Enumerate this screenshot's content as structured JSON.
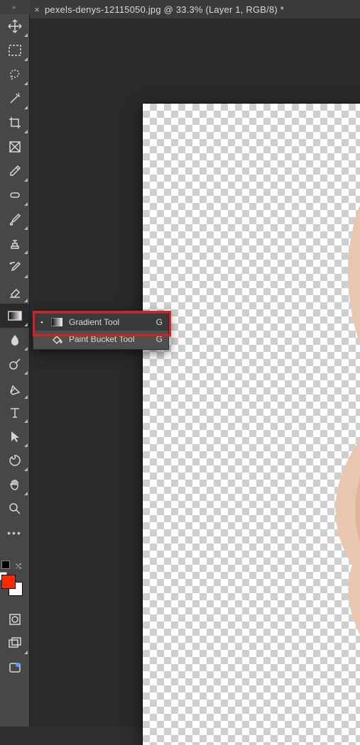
{
  "tab": {
    "close_glyph": "×",
    "title": "pexels-denys-12115050.jpg @ 33.3% (Layer 1, RGB/8) *"
  },
  "toolbar": {
    "tools": [
      {
        "name": "move-tool",
        "active": false,
        "flyout": true
      },
      {
        "name": "rectangular-marquee-tool",
        "active": false,
        "flyout": true
      },
      {
        "name": "lasso-tool",
        "active": false,
        "flyout": true
      },
      {
        "name": "magic-wand-tool",
        "active": false,
        "flyout": true
      },
      {
        "name": "crop-tool",
        "active": false,
        "flyout": true
      },
      {
        "name": "frame-tool",
        "active": false,
        "flyout": false
      },
      {
        "name": "eyedropper-tool",
        "active": false,
        "flyout": true
      },
      {
        "name": "healing-brush-tool",
        "active": false,
        "flyout": true
      },
      {
        "name": "brush-tool",
        "active": false,
        "flyout": true
      },
      {
        "name": "clone-stamp-tool",
        "active": false,
        "flyout": true
      },
      {
        "name": "history-brush-tool",
        "active": false,
        "flyout": true
      },
      {
        "name": "eraser-tool",
        "active": false,
        "flyout": true
      },
      {
        "name": "gradient-tool",
        "active": true,
        "flyout": true
      },
      {
        "name": "blur-tool",
        "active": false,
        "flyout": true
      },
      {
        "name": "dodge-tool",
        "active": false,
        "flyout": true
      },
      {
        "name": "pen-tool",
        "active": false,
        "flyout": true
      },
      {
        "name": "type-tool",
        "active": false,
        "flyout": true
      },
      {
        "name": "path-selection-tool",
        "active": false,
        "flyout": true
      },
      {
        "name": "shape-tool",
        "active": false,
        "flyout": true
      },
      {
        "name": "hand-tool",
        "active": false,
        "flyout": true
      },
      {
        "name": "zoom-tool",
        "active": false,
        "flyout": false
      }
    ]
  },
  "flyout": {
    "items": [
      {
        "selected": true,
        "icon": "gradient-icon",
        "label": "Gradient Tool",
        "shortcut": "G"
      },
      {
        "selected": false,
        "icon": "paint-bucket-icon",
        "label": "Paint Bucket Tool",
        "shortcut": "G"
      }
    ]
  },
  "colors": {
    "foreground": "#ff2a00",
    "background": "#ffffff"
  },
  "expand_glyph": "»",
  "more_glyph": "•••",
  "swap_glyph": "⤭"
}
